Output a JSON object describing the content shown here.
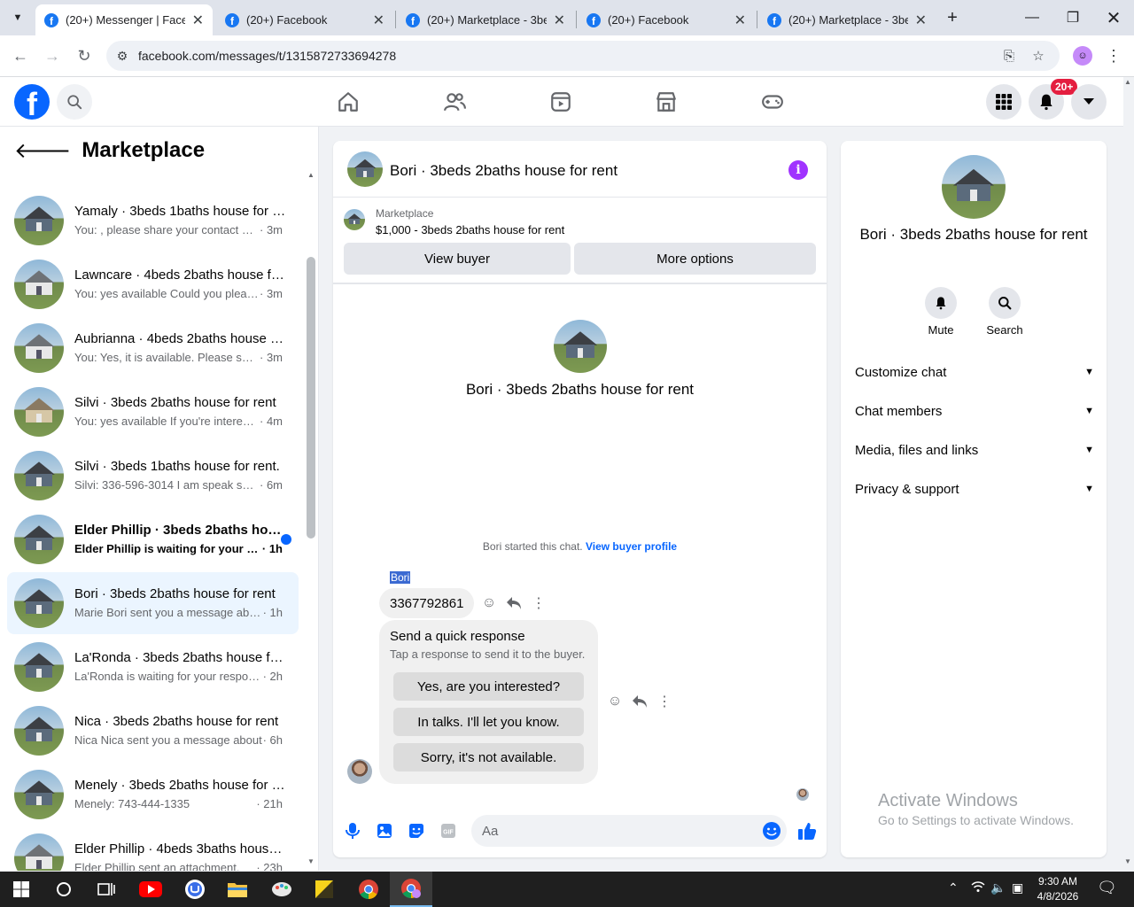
{
  "browser": {
    "tabs": [
      {
        "title": "(20+) Messenger | Facebook",
        "active": true
      },
      {
        "title": "(20+) Facebook",
        "active": false
      },
      {
        "title": "(20+) Marketplace - 3beds",
        "active": false
      },
      {
        "title": "(20+) Facebook",
        "active": false
      },
      {
        "title": "(20+) Marketplace - 3beds",
        "active": false
      }
    ],
    "url": "facebook.com/messages/t/1315872733694278"
  },
  "fb_header": {
    "logo": "f",
    "notifications_badge": "20+"
  },
  "sidebar": {
    "title": "Marketplace",
    "conversations": [
      {
        "name": "Yamaly · 3beds 1baths house for rent",
        "snippet": "You: , please share your contact number",
        "time": "· 3m",
        "art": "dark",
        "unread": false,
        "active": false
      },
      {
        "name": "Lawncare · 4beds 2baths house for rent",
        "snippet": "You: yes available Could you please share",
        "time": "· 3m",
        "art": "white",
        "unread": false,
        "active": false
      },
      {
        "name": "Aubrianna · 4beds 2baths house for rent",
        "snippet": "You: Yes, it is available. Please share",
        "time": "· 3m",
        "art": "white",
        "unread": false,
        "active": false
      },
      {
        "name": "Silvi · 3beds 2baths house for rent",
        "snippet": "You: yes available If you're interested",
        "time": "· 4m",
        "art": "beige",
        "unread": false,
        "active": false
      },
      {
        "name": "Silvi · 3beds 1baths house for rent.",
        "snippet": "Silvi: 336-596-3014 I am speak spanish",
        "time": "· 6m",
        "art": "dark",
        "unread": false,
        "active": false
      },
      {
        "name": "Elder Phillip · 3beds 2baths house for rent",
        "snippet": "Elder Phillip is waiting for your response",
        "time": "· 1h",
        "art": "dark",
        "unread": true,
        "active": false
      },
      {
        "name": "Bori · 3beds 2baths house for rent",
        "snippet": "Marie Bori sent you a message about",
        "time": "· 1h",
        "art": "dark",
        "unread": false,
        "active": true
      },
      {
        "name": "La'Ronda · 3beds 2baths house for rent",
        "snippet": "La'Ronda is waiting for your response",
        "time": "· 2h",
        "art": "dark",
        "unread": false,
        "active": false
      },
      {
        "name": "Nica · 3beds 2baths house for rent",
        "snippet": "Nica Nica sent you a message about",
        "time": "· 6h",
        "art": "dark",
        "unread": false,
        "active": false
      },
      {
        "name": "Menely · 3beds 2baths house for rent",
        "snippet": "Menely: 743-444-1335",
        "time": "· 21h",
        "art": "dark",
        "unread": false,
        "active": false
      },
      {
        "name": "Elder Phillip · 4beds 3baths house for rent",
        "snippet": "Elder Phillip sent an attachment.",
        "time": "· 23h",
        "art": "white",
        "unread": false,
        "active": false
      }
    ]
  },
  "chat": {
    "title": "Bori · 3beds 2baths house for rent",
    "marketplace_label": "Marketplace",
    "listing": "$1,000 - 3beds 2baths house for rent",
    "view_buyer": "View buyer",
    "more_options": "More options",
    "intro_name": "Bori · 3beds 2baths house for rent",
    "started_text": "Bori started this chat.",
    "view_buyer_profile": "View buyer profile",
    "sender": "Bori",
    "message": "3367792861",
    "quick_response": {
      "title": "Send a quick response",
      "subtitle": "Tap a response to send it to the buyer.",
      "options": [
        "Yes, are you interested?",
        "In talks. I'll let you know.",
        "Sorry, it's not available."
      ]
    },
    "composer_placeholder": "Aa"
  },
  "info_panel": {
    "name": "Bori · 3beds 2baths house for rent",
    "mute": "Mute",
    "search": "Search",
    "sections": [
      "Customize chat",
      "Chat members",
      "Media, files and links",
      "Privacy & support"
    ]
  },
  "watermark": {
    "line1": "Activate Windows",
    "line2": "Go to Settings to activate Windows."
  },
  "taskbar": {
    "time": "9:30 AM",
    "date": "4/8/2026"
  },
  "colors": {
    "facebook_blue": "#0866ff",
    "messenger_purple": "#a033ff",
    "badge_red": "#e41e3f"
  }
}
